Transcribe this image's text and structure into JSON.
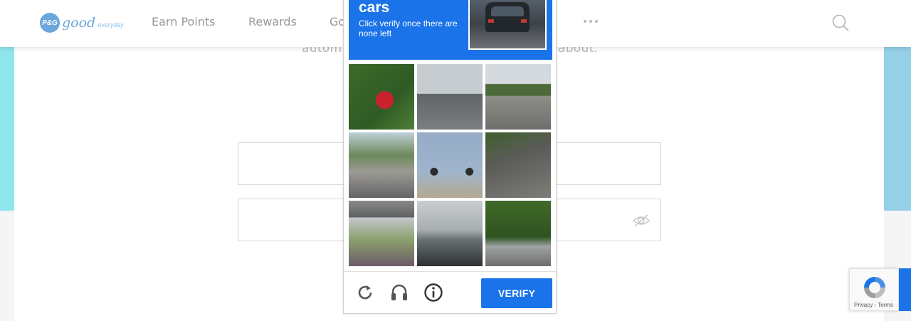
{
  "header": {
    "logo_badge": "P&G",
    "logo_word": "good",
    "logo_sub": "everyday",
    "nav": [
      "Earn Points",
      "Rewards",
      "Go"
    ],
    "more_icon": "more-dots-icon",
    "search_icon": "search-icon"
  },
  "page": {
    "text_left": "autom",
    "text_right": "about.",
    "password_icon": "eye-hidden-icon"
  },
  "captcha": {
    "title": "cars",
    "instruction": "Click verify once there are none left",
    "tiles": [
      "tile-1",
      "tile-2",
      "tile-3",
      "tile-4",
      "tile-5",
      "tile-6",
      "tile-7",
      "tile-8",
      "tile-9"
    ],
    "verify_label": "VERIFY",
    "icons": [
      "reload-icon",
      "headphones-icon",
      "info-icon"
    ],
    "colors": {
      "accent": "#1a73e8"
    }
  },
  "badge": {
    "text": "Privacy - Terms"
  }
}
